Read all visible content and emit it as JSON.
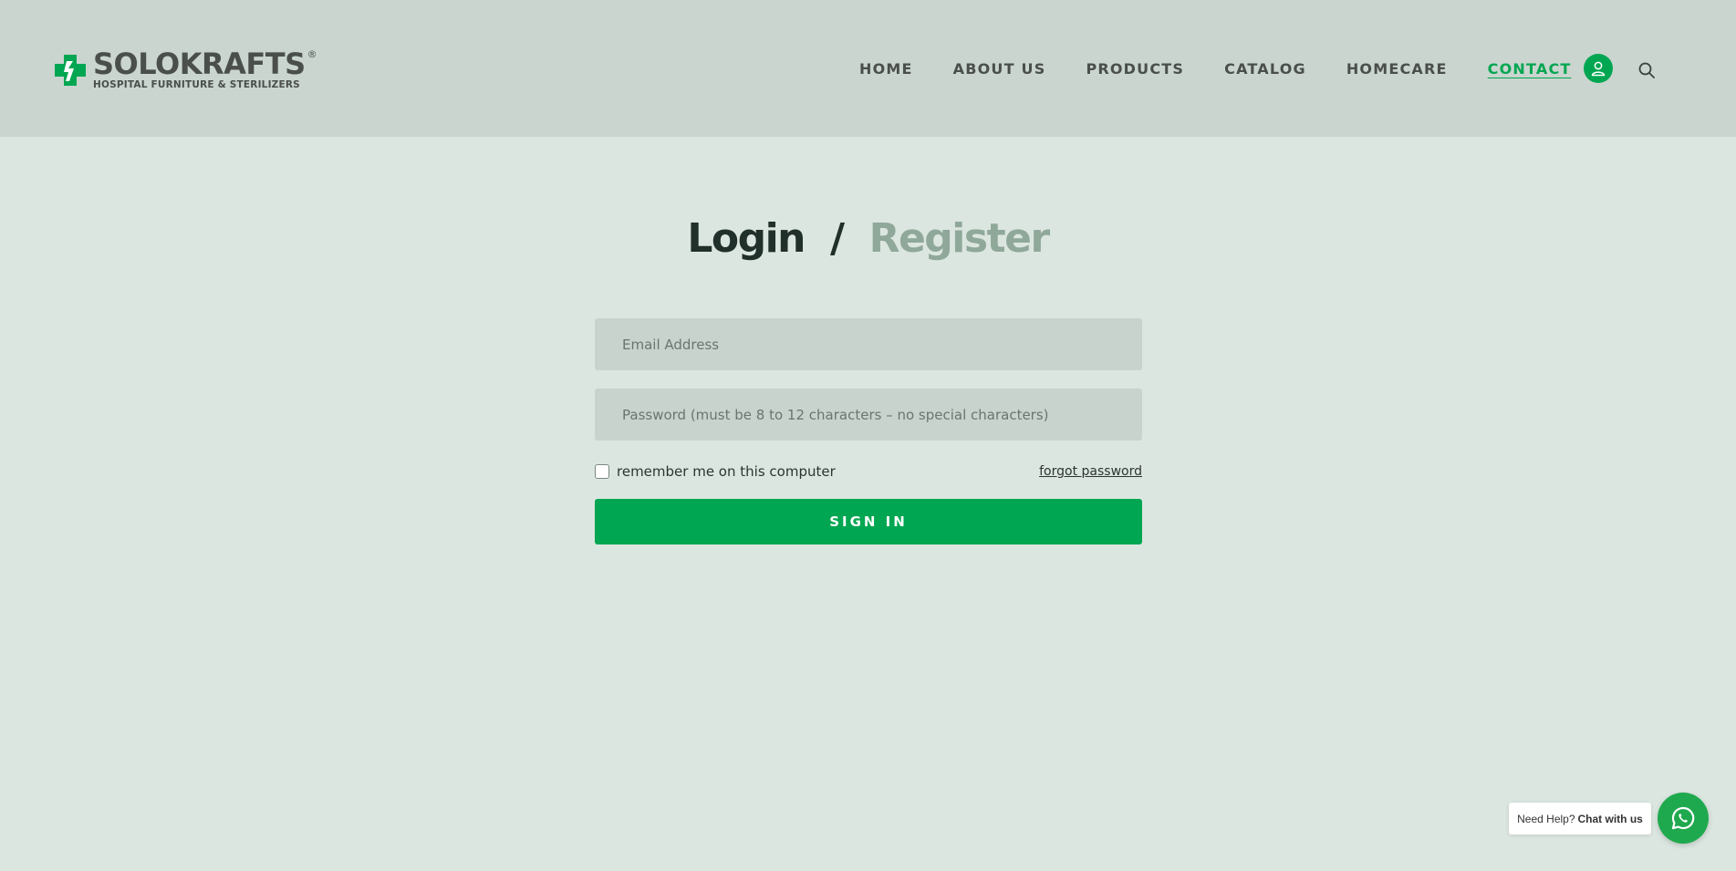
{
  "brand": {
    "name": "SOLOKRAFTS",
    "registered_mark": "®",
    "tagline": "HOSPITAL FURNITURE & STERILIZERS",
    "logo_icon": "cross-wrench-logo-icon",
    "accent_color": "#00a651"
  },
  "nav": {
    "items": [
      {
        "label": "HOME"
      },
      {
        "label": "ABOUT US"
      },
      {
        "label": "PRODUCTS"
      },
      {
        "label": "CATALOG"
      },
      {
        "label": "HOMECARE"
      },
      {
        "label": "CONTACT",
        "active": true
      }
    ],
    "account_icon": "user-icon",
    "search_icon": "search-icon"
  },
  "auth": {
    "login_tab": "Login",
    "separator": "/",
    "register_tab": "Register",
    "email_placeholder": "Email Address",
    "password_placeholder": "Password (must be 8 to 12 characters – no special characters)",
    "remember_label": "remember me on this computer",
    "remember_checked": false,
    "forgot_label": "forgot password",
    "signin_label": "SIGN IN"
  },
  "help": {
    "prefix": "Need Help?",
    "action": "Chat with us",
    "icon": "whatsapp-icon"
  }
}
